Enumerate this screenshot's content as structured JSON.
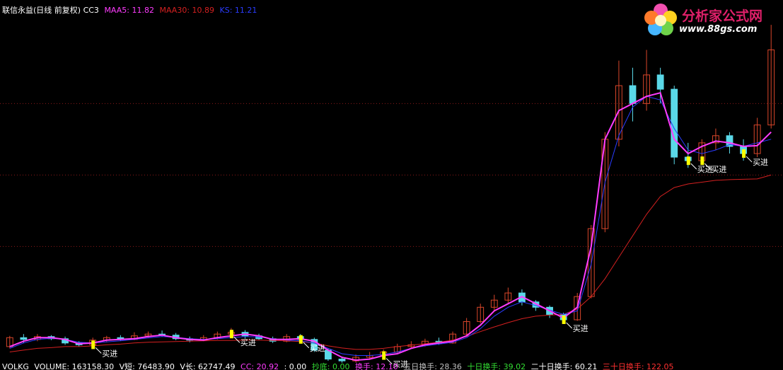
{
  "header": {
    "title": "联信永益(日线 前复权) CC3",
    "maa5_label": "MAA5: 11.82",
    "maa30_label": "MAA30: 10.89",
    "ks_label": "KS: 11.21"
  },
  "footer": {
    "volkg": "VOLKG",
    "volume": "VOLUME: 163158.30",
    "vshort": "V短: 76483.90",
    "vlong": "V长: 62747.49",
    "cc": "CC: 20.92",
    "zero": ": 0.00",
    "chaodi": "抄底: 0.00",
    "huanshou": "换手: 12.10",
    "wuri": "五日换手: 28.36",
    "shiri": "十日换手: 39.02",
    "ershiri": "二十日换手: 60.21",
    "sanshiri": "三十日换手: 122.05"
  },
  "logo": {
    "name": "分析家公式网",
    "url": "www.88gs.com"
  },
  "colors": {
    "background": "#000000",
    "grid": "#8b1a1a",
    "candle_up": "#d9462a",
    "candle_down": "#5ad8e8",
    "maa5": "#ff3cff",
    "maa30": "#d42020",
    "ks": "#2a3cff",
    "buy_bar": "#ffff00",
    "buy_text": "#ffffff",
    "header_text": "#ffffff",
    "footer_white": "#ffffff",
    "footer_magenta": "#ff3cff",
    "footer_green": "#33dd33",
    "footer_gray": "#c0c0c0",
    "footer_red": "#ff3030"
  },
  "chart_data": {
    "type": "candlestick",
    "title": "联信永益(日线 前复权) CC3",
    "ylim": [
      6.0,
      15.5
    ],
    "grid": "horizontal dotted",
    "series": [
      {
        "name": "MAA5",
        "values": [
          6.2,
          6.35,
          6.45,
          6.45,
          6.4,
          6.28,
          6.3,
          6.38,
          6.4,
          6.42,
          6.48,
          6.52,
          6.45,
          6.4,
          6.38,
          6.45,
          6.5,
          6.55,
          6.5,
          6.4,
          6.4,
          6.42,
          6.35,
          6.1,
          5.9,
          5.82,
          5.85,
          5.95,
          6.0,
          6.15,
          6.25,
          6.3,
          6.35,
          6.5,
          6.8,
          7.2,
          7.4,
          7.6,
          7.4,
          7.2,
          7.0,
          7.3,
          9.0,
          12.0,
          12.8,
          13.0,
          13.2,
          13.3,
          12.0,
          11.6,
          11.8,
          11.95,
          11.9,
          11.8,
          11.82,
          12.2
        ]
      },
      {
        "name": "MAA30",
        "values": [
          6.05,
          6.1,
          6.15,
          6.17,
          6.2,
          6.2,
          6.22,
          6.25,
          6.27,
          6.3,
          6.32,
          6.33,
          6.34,
          6.35,
          6.36,
          6.37,
          6.37,
          6.38,
          6.38,
          6.37,
          6.36,
          6.34,
          6.3,
          6.22,
          6.16,
          6.12,
          6.12,
          6.15,
          6.2,
          6.24,
          6.28,
          6.32,
          6.38,
          6.48,
          6.62,
          6.75,
          6.87,
          6.98,
          7.05,
          7.08,
          7.1,
          7.25,
          7.6,
          8.1,
          8.7,
          9.3,
          9.9,
          10.4,
          10.65,
          10.75,
          10.8,
          10.85,
          10.87,
          10.88,
          10.89,
          11.0
        ]
      },
      {
        "name": "KS",
        "values": [
          6.15,
          6.3,
          6.4,
          6.43,
          6.4,
          6.32,
          6.3,
          6.33,
          6.36,
          6.4,
          6.44,
          6.48,
          6.46,
          6.42,
          6.4,
          6.42,
          6.45,
          6.48,
          6.47,
          6.42,
          6.38,
          6.36,
          6.3,
          6.15,
          6.0,
          5.95,
          5.95,
          5.98,
          6.05,
          6.15,
          6.22,
          6.27,
          6.32,
          6.45,
          6.7,
          7.05,
          7.3,
          7.45,
          7.35,
          7.22,
          7.1,
          7.2,
          8.5,
          10.8,
          12.1,
          12.9,
          13.2,
          13.1,
          12.3,
          11.7,
          11.6,
          11.7,
          11.85,
          11.8,
          11.9,
          12.0
        ]
      },
      {
        "name": "candles",
        "values": [
          [
            6.2,
            6.45,
            6.15,
            6.5
          ],
          [
            6.45,
            6.4,
            6.3,
            6.55
          ],
          [
            6.4,
            6.48,
            6.35,
            6.55
          ],
          [
            6.48,
            6.42,
            6.38,
            6.52
          ],
          [
            6.42,
            6.3,
            6.25,
            6.48
          ],
          [
            6.3,
            6.25,
            6.2,
            6.35
          ],
          [
            6.25,
            6.38,
            6.22,
            6.45
          ],
          [
            6.38,
            6.45,
            6.32,
            6.5
          ],
          [
            6.45,
            6.4,
            6.36,
            6.52
          ],
          [
            6.4,
            6.5,
            6.38,
            6.6
          ],
          [
            6.5,
            6.55,
            6.45,
            6.62
          ],
          [
            6.55,
            6.52,
            6.48,
            6.65
          ],
          [
            6.52,
            6.42,
            6.38,
            6.58
          ],
          [
            6.42,
            6.38,
            6.32,
            6.48
          ],
          [
            6.38,
            6.45,
            6.35,
            6.52
          ],
          [
            6.45,
            6.55,
            6.4,
            6.62
          ],
          [
            6.55,
            6.6,
            6.48,
            6.72
          ],
          [
            6.6,
            6.5,
            6.42,
            6.66
          ],
          [
            6.5,
            6.42,
            6.38,
            6.56
          ],
          [
            6.42,
            6.35,
            6.3,
            6.48
          ],
          [
            6.35,
            6.48,
            6.32,
            6.55
          ],
          [
            6.48,
            6.4,
            6.35,
            6.55
          ],
          [
            6.4,
            6.1,
            6.05,
            6.45
          ],
          [
            6.1,
            5.85,
            5.8,
            6.15
          ],
          [
            5.85,
            5.8,
            5.75,
            5.92
          ],
          [
            5.8,
            5.9,
            5.75,
            5.98
          ],
          [
            5.9,
            5.95,
            5.85,
            6.05
          ],
          [
            5.95,
            6.05,
            5.92,
            6.12
          ],
          [
            6.05,
            6.2,
            6.0,
            6.28
          ],
          [
            6.2,
            6.25,
            6.15,
            6.35
          ],
          [
            6.25,
            6.35,
            6.2,
            6.42
          ],
          [
            6.35,
            6.3,
            6.25,
            6.45
          ],
          [
            6.3,
            6.55,
            6.28,
            6.62
          ],
          [
            6.55,
            6.9,
            6.5,
            7.0
          ],
          [
            6.9,
            7.3,
            6.85,
            7.4
          ],
          [
            7.3,
            7.5,
            7.2,
            7.65
          ],
          [
            7.5,
            7.7,
            7.4,
            7.85
          ],
          [
            7.7,
            7.45,
            7.35,
            7.8
          ],
          [
            7.45,
            7.3,
            7.2,
            7.5
          ],
          [
            7.3,
            7.1,
            7.0,
            7.35
          ],
          [
            7.1,
            6.95,
            6.9,
            7.15
          ],
          [
            6.95,
            7.6,
            6.92,
            7.7
          ],
          [
            7.6,
            9.5,
            7.55,
            9.6
          ],
          [
            9.5,
            12.0,
            9.4,
            12.2
          ],
          [
            12.0,
            13.5,
            11.8,
            14.2
          ],
          [
            13.5,
            13.0,
            12.5,
            14.0
          ],
          [
            13.0,
            13.8,
            12.8,
            14.5
          ],
          [
            13.8,
            13.4,
            13.0,
            14.0
          ],
          [
            13.4,
            11.5,
            11.3,
            13.5
          ],
          [
            11.5,
            11.4,
            11.2,
            11.9
          ],
          [
            11.4,
            11.9,
            11.3,
            12.0
          ],
          [
            11.9,
            12.1,
            11.7,
            12.3
          ],
          [
            12.1,
            11.8,
            11.6,
            12.2
          ],
          [
            11.8,
            11.6,
            11.4,
            12.0
          ],
          [
            11.6,
            12.4,
            11.5,
            12.6
          ],
          [
            12.4,
            14.5,
            12.3,
            15.2
          ]
        ]
      }
    ],
    "candle_format": "[open, close, low, high]",
    "buy_signals": [
      {
        "index": 6,
        "label": "买进"
      },
      {
        "index": 16,
        "label": "买进"
      },
      {
        "index": 21,
        "label": "买进"
      },
      {
        "index": 27,
        "label": "买进"
      },
      {
        "index": 40,
        "label": "买进"
      },
      {
        "index": 49,
        "label": "买进"
      },
      {
        "index": 50,
        "label": "买进"
      },
      {
        "index": 53,
        "label": "买进"
      }
    ]
  }
}
